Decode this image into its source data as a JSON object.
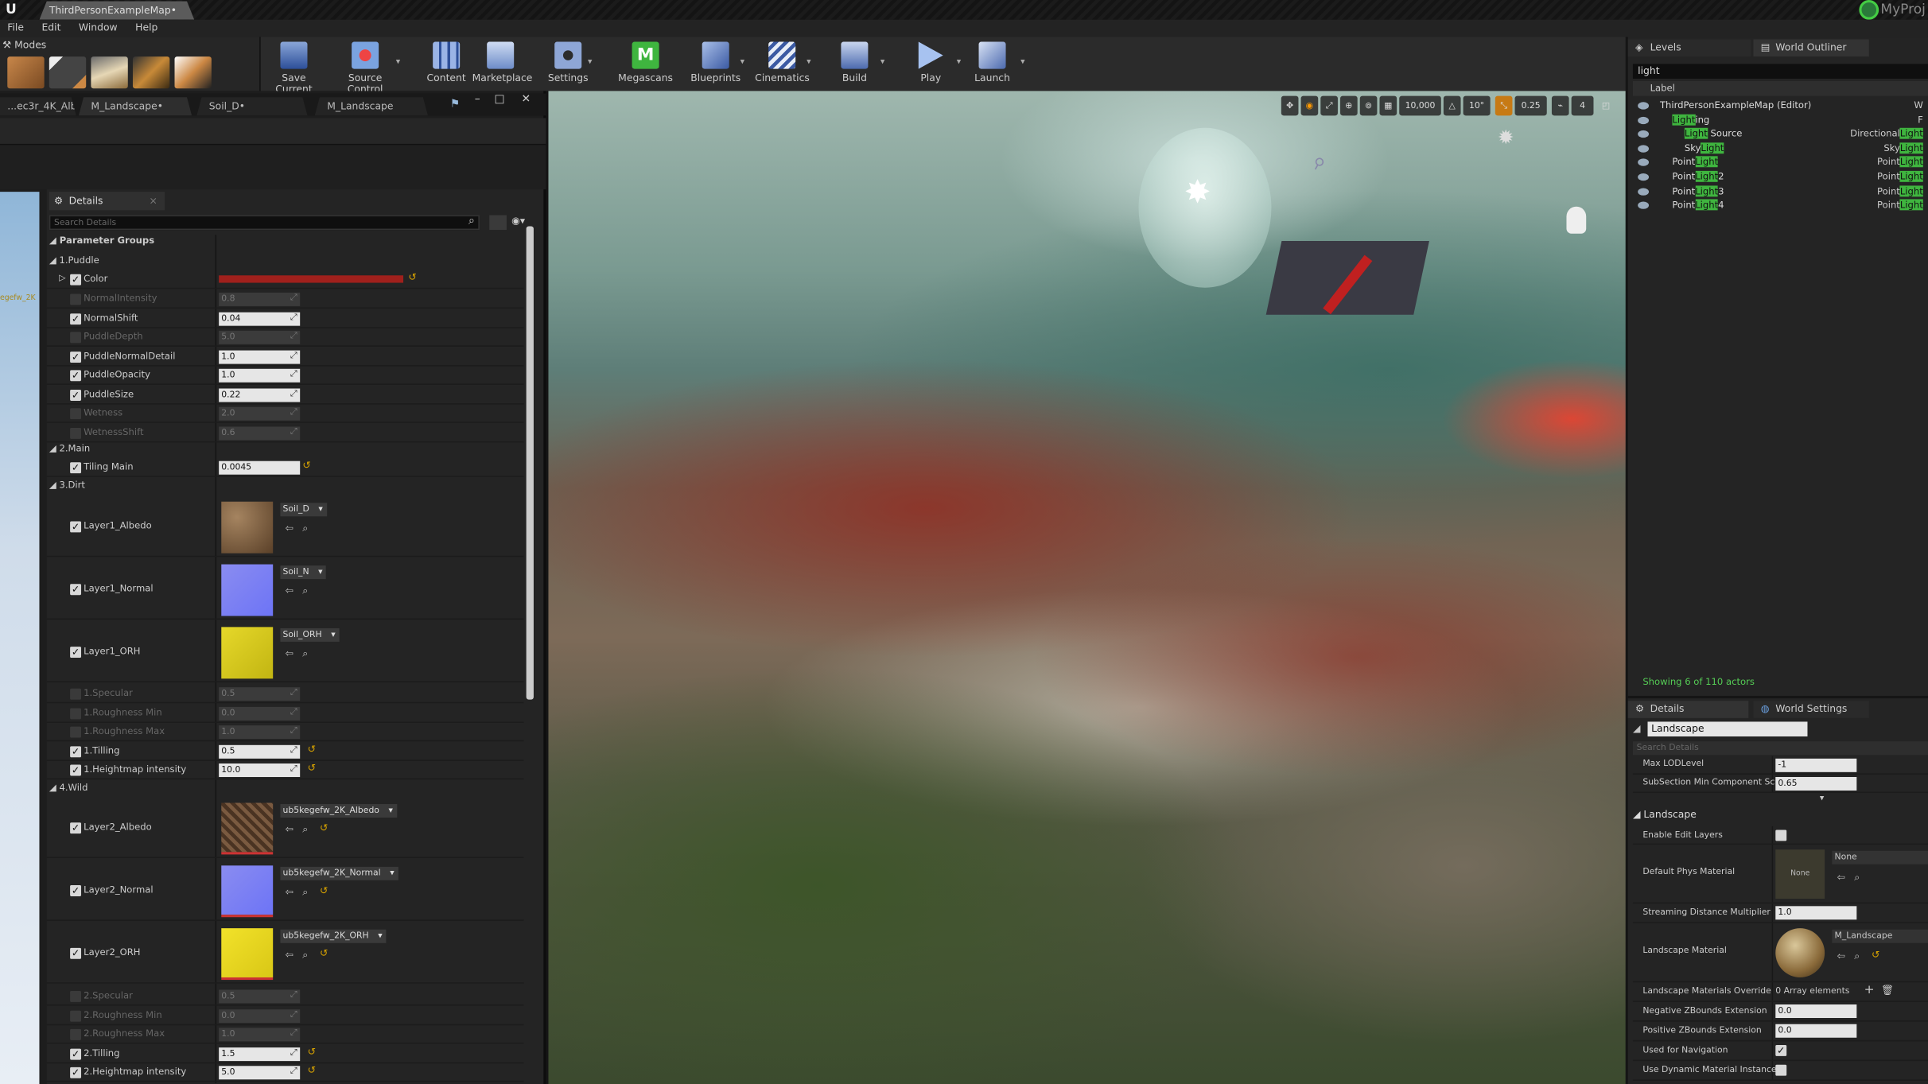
{
  "app": {
    "doc_tab": "ThirdPersonExampleMap•",
    "project": "MyProj"
  },
  "menu": [
    "File",
    "Edit",
    "Window",
    "Help"
  ],
  "modes": {
    "label": "Modes"
  },
  "toolbar": {
    "save_current": "Save Current",
    "source_control": "Source Control",
    "content": "Content",
    "marketplace": "Marketplace",
    "settings": "Settings",
    "megascans": "Megascans",
    "blueprints": "Blueprints",
    "cinematics": "Cinematics",
    "build": "Build",
    "play": "Play",
    "launch": "Launch"
  },
  "editor_tabs": [
    "...ec3r_4K_Alb•",
    "M_Landscape•",
    "Soil_D•",
    "M_Landscape"
  ],
  "details": {
    "tab": "Details",
    "search_placeholder": "Search Details",
    "parameter_groups": "Parameter Groups",
    "group_puddle": "1.Puddle",
    "group_main": "2.Main",
    "group_dirt": "3.Dirt",
    "group_wild": "4.Wild",
    "color_label": "Color",
    "rows_puddle": [
      {
        "name": "NormalIntensity",
        "value": "0.8",
        "enabled": false
      },
      {
        "name": "NormalShift",
        "value": "0.04",
        "enabled": true
      },
      {
        "name": "PuddleDepth",
        "value": "5.0",
        "enabled": false
      },
      {
        "name": "PuddleNormalDetail",
        "value": "1.0",
        "enabled": true
      },
      {
        "name": "PuddleOpacity",
        "value": "1.0",
        "enabled": true
      },
      {
        "name": "PuddleSize",
        "value": "0.22",
        "enabled": true
      },
      {
        "name": "Wetness",
        "value": "2.0",
        "enabled": false
      },
      {
        "name": "WetnessShift",
        "value": "0.6",
        "enabled": false
      }
    ],
    "tiling_main": {
      "name": "Tiling Main",
      "value": "0.0045"
    },
    "dirt_textures": [
      {
        "name": "Layer1_Albedo",
        "asset": "Soil_D"
      },
      {
        "name": "Layer1_Normal",
        "asset": "Soil_N"
      },
      {
        "name": "Layer1_ORH",
        "asset": "Soil_ORH"
      }
    ],
    "rows_dirt": [
      {
        "name": "1.Specular",
        "value": "0.5",
        "enabled": false
      },
      {
        "name": "1.Roughness Min",
        "value": "0.0",
        "enabled": false
      },
      {
        "name": "1.Roughness Max",
        "value": "1.0",
        "enabled": false
      },
      {
        "name": "1.Tilling",
        "value": "0.5",
        "enabled": true
      },
      {
        "name": "1.Heightmap intensity",
        "value": "10.0",
        "enabled": true
      }
    ],
    "wild_textures": [
      {
        "name": "Layer2_Albedo",
        "asset": "ub5kegefw_2K_Albedo"
      },
      {
        "name": "Layer2_Normal",
        "asset": "ub5kegefw_2K_Normal"
      },
      {
        "name": "Layer2_ORH",
        "asset": "ub5kegefw_2K_ORH"
      }
    ],
    "rows_wild": [
      {
        "name": "2.Specular",
        "value": "0.5",
        "enabled": false
      },
      {
        "name": "2.Roughness Min",
        "value": "0.0",
        "enabled": false
      },
      {
        "name": "2.Roughness Max",
        "value": "1.0",
        "enabled": false
      },
      {
        "name": "2.Tilling",
        "value": "1.5",
        "enabled": true
      },
      {
        "name": "2.Heightmap intensity",
        "value": "5.0",
        "enabled": true
      }
    ],
    "left_strip_text": "egefw_2K"
  },
  "viewport": {
    "grid_snap": "10,000",
    "rot_snap": "10°",
    "scale_snap": "0.25",
    "cam_speed": "4"
  },
  "outliner": {
    "levels_tab": "Levels",
    "tab": "World Outliner",
    "search": "light",
    "col_label": "Label",
    "items": [
      {
        "label": "ThirdPersonExampleMap (Editor)",
        "type": "W",
        "indent": 0
      },
      {
        "label": "Lighting",
        "type": "F",
        "indent": 1
      },
      {
        "label": "Light Source",
        "type": "DirectionalLight",
        "indent": 2
      },
      {
        "label": "SkyLight",
        "type": "SkyLight",
        "indent": 2
      },
      {
        "label": "PointLight",
        "type": "PointLight",
        "indent": 1
      },
      {
        "label": "PointLight2",
        "type": "PointLight",
        "indent": 1
      },
      {
        "label": "PointLight3",
        "type": "PointLight",
        "indent": 1
      },
      {
        "label": "PointLight4",
        "type": "PointLight",
        "indent": 1
      }
    ],
    "showing": "Showing 6 of 110 actors"
  },
  "details_right": {
    "tab": "Details",
    "world_settings_tab": "World Settings",
    "object_name": "Landscape",
    "search_placeholder": "Search Details",
    "max_lod_label": "Max LODLevel",
    "max_lod_value": "-1",
    "subsection_label": "SubSection Min Component Sc",
    "subsection_value": "0.65",
    "section_landscape": "Landscape",
    "enable_edit_layers": "Enable Edit Layers",
    "default_phys_material": "Default Phys Material",
    "phys_thumb": "None",
    "phys_value": "None",
    "streaming_distance_label": "Streaming Distance Multiplier",
    "streaming_distance_value": "1.0",
    "landscape_material_label": "Landscape Material",
    "landscape_material_value": "M_Landscape",
    "materials_override_label": "Landscape Materials Override",
    "materials_override_value": "0 Array elements",
    "neg_z_label": "Negative ZBounds Extension",
    "neg_z_value": "0.0",
    "pos_z_label": "Positive ZBounds Extension",
    "pos_z_value": "0.0",
    "navigation_label": "Used for Navigation",
    "dynamic_material_label": "Use Dynamic Material Instance"
  },
  "colors": {
    "accent_green": "#3fb53f",
    "puddle_color": "#a0201c"
  }
}
